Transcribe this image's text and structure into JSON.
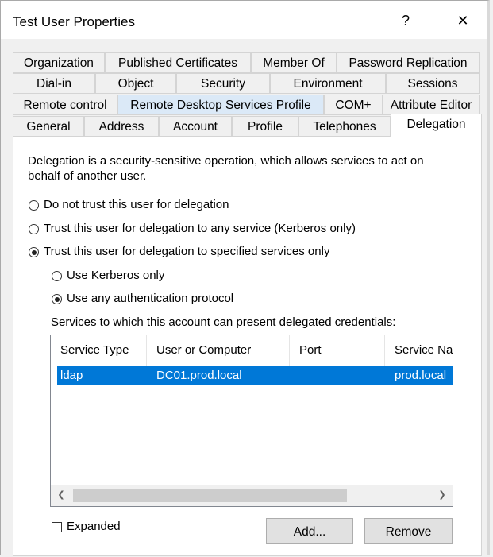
{
  "window": {
    "title": "Test User Properties",
    "help_glyph": "?",
    "close_glyph": "✕"
  },
  "tabs": {
    "row1": [
      "Organization",
      "Published Certificates",
      "Member Of",
      "Password Replication"
    ],
    "row2": [
      "Dial-in",
      "Object",
      "Security",
      "Environment",
      "Sessions"
    ],
    "row3": [
      "Remote control",
      "Remote Desktop Services Profile",
      "COM+",
      "Attribute Editor"
    ],
    "row4": [
      "General",
      "Address",
      "Account",
      "Profile",
      "Telephones",
      "Delegation"
    ],
    "active": "Delegation"
  },
  "delegation": {
    "intro_line1": "Delegation is a security-sensitive operation, which allows services to act on",
    "intro_line2": "behalf of another user.",
    "options": [
      {
        "label": "Do not trust this user for delegation",
        "selected": false
      },
      {
        "label": "Trust this user for delegation to any service (Kerberos only)",
        "selected": false
      },
      {
        "label": "Trust this user for delegation to specified services only",
        "selected": true
      }
    ],
    "sub_options": [
      {
        "label": "Use Kerberos only",
        "selected": false
      },
      {
        "label": "Use any authentication protocol",
        "selected": true
      }
    ],
    "services_label": "Services to which this account can present delegated credentials:",
    "columns": [
      "Service Type",
      "User or Computer",
      "Port",
      "Service Na"
    ],
    "rows": [
      {
        "service_type": "ldap",
        "user_or_computer": "DC01.prod.local",
        "port": "",
        "service_name": "prod.local",
        "selected": true
      }
    ],
    "expanded_label": "Expanded",
    "expanded_checked": false,
    "add_button": "Add...",
    "remove_button": "Remove"
  },
  "colors": {
    "selection": "#0078d7",
    "tab_highlight": "#dbe9f7"
  }
}
